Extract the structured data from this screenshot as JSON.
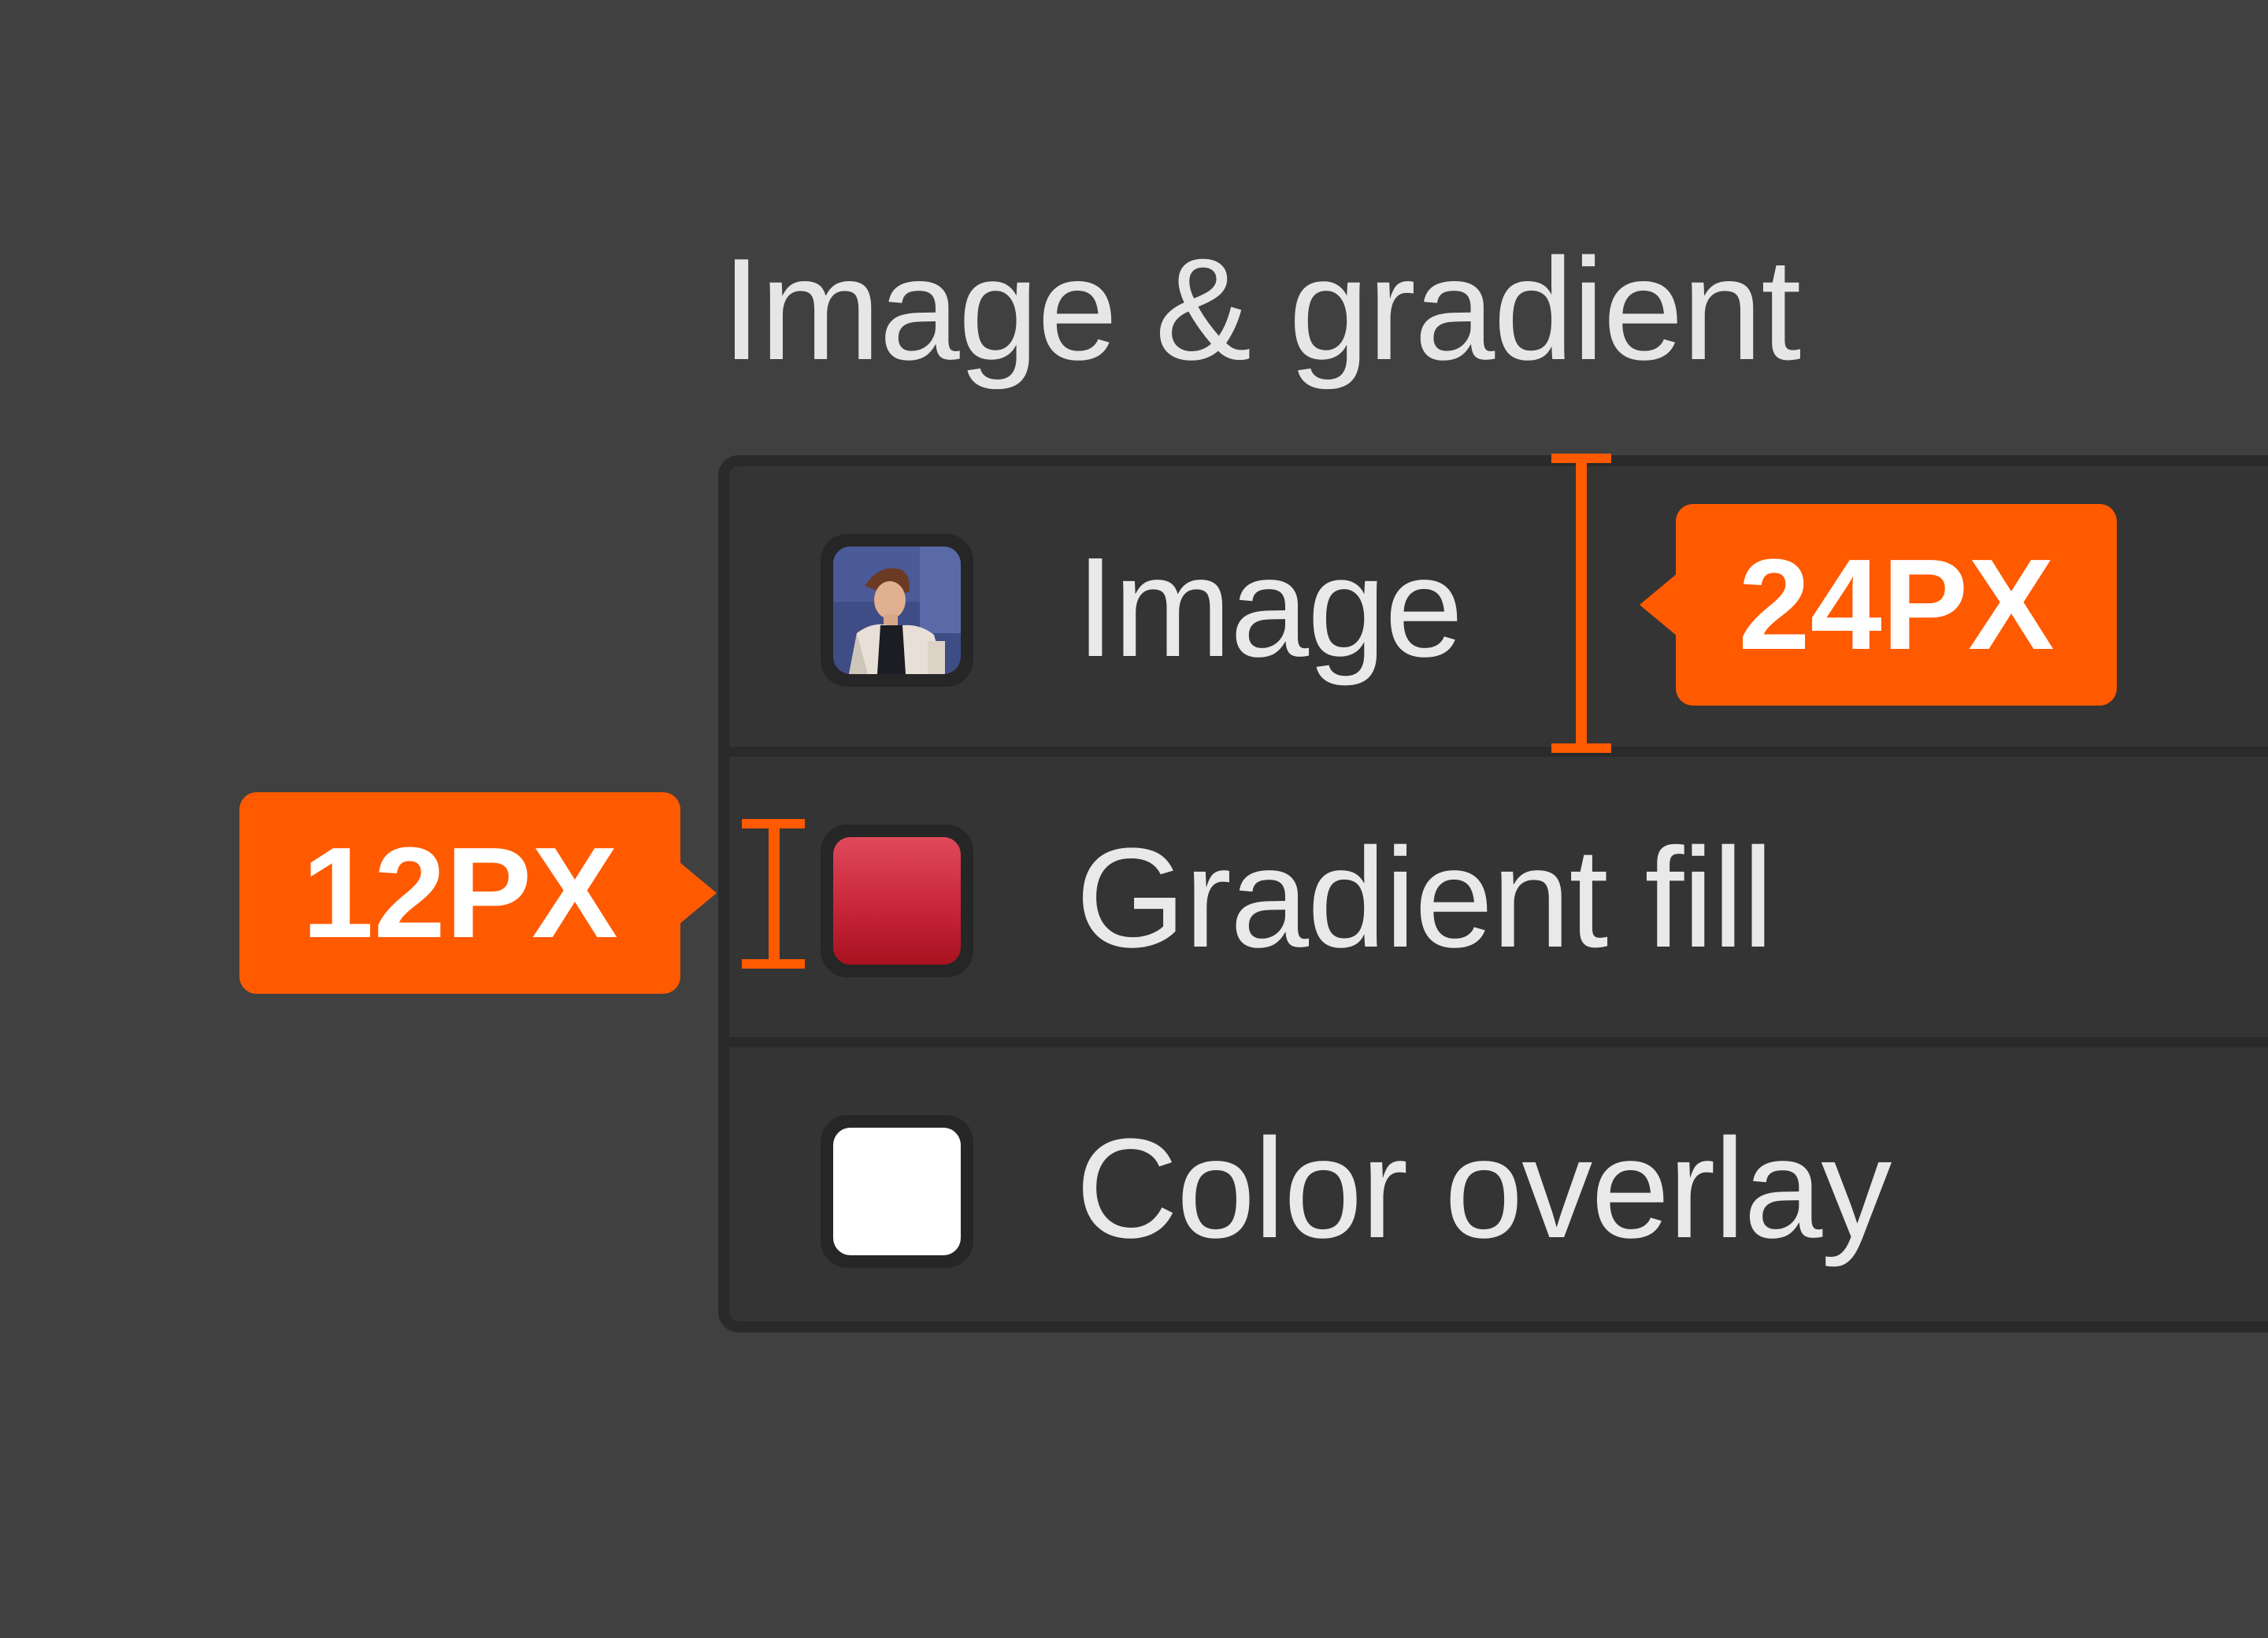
{
  "section": {
    "title": "Image & gradient"
  },
  "layers": [
    {
      "label": "Image",
      "thumbnail": "photo-thumbnail"
    },
    {
      "label": "Gradient fill",
      "thumbnail": "red-gradient-swatch",
      "gradient_colors": [
        "#e0495a",
        "#a8121f"
      ]
    },
    {
      "label": "Color overlay",
      "thumbnail": "white-swatch",
      "color": "#ffffff"
    }
  ],
  "annotations": {
    "row_height_label": "24PX",
    "left_padding_label": "12PX",
    "accent_color": "#ff5a00"
  },
  "colors": {
    "background": "#404040",
    "panel": "#343434",
    "panel_border": "#2a2a2a",
    "text": "#e9e9e9"
  }
}
